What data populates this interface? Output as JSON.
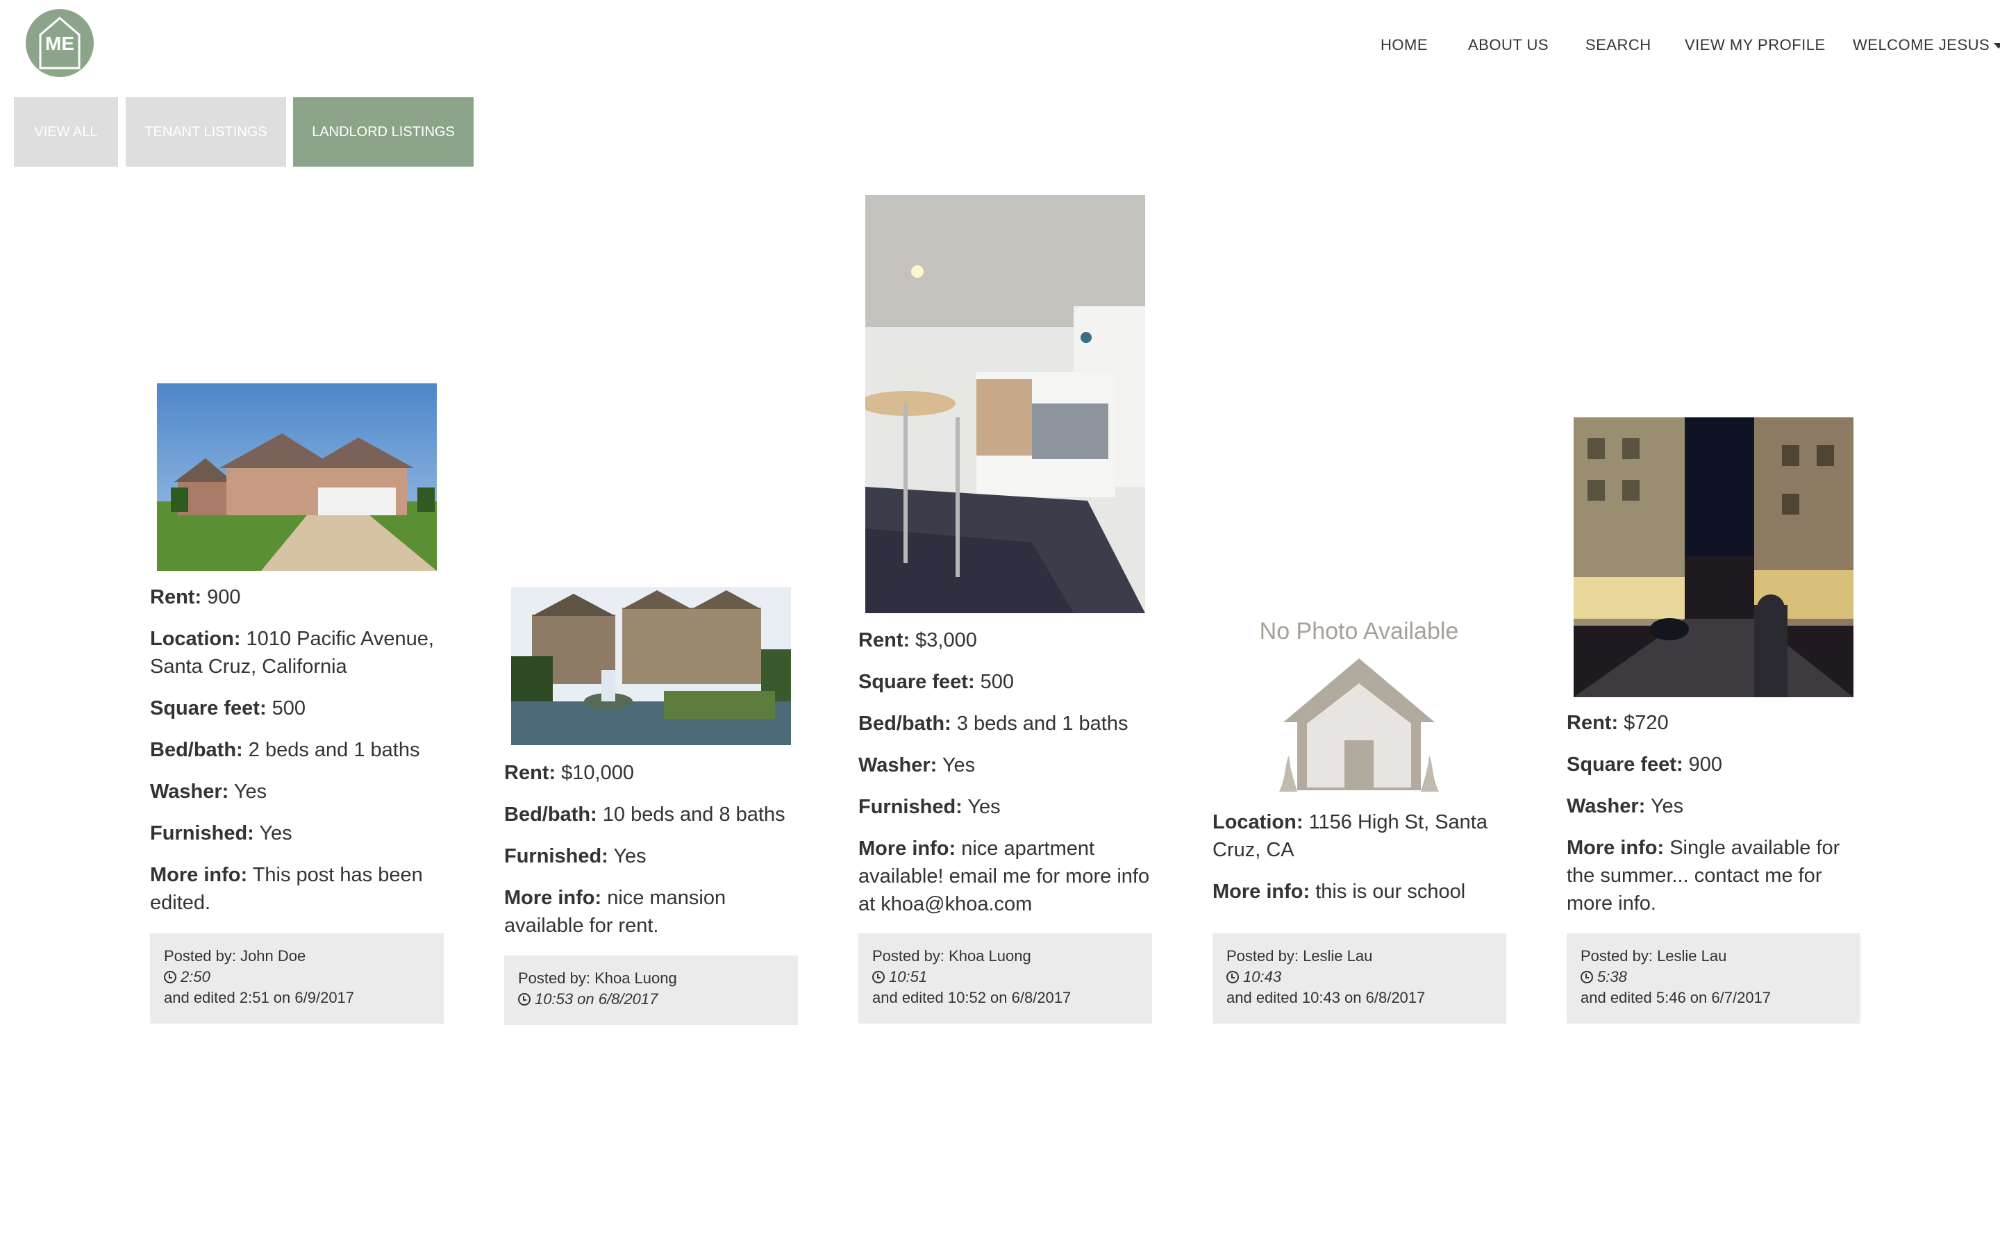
{
  "header": {
    "logo_text": "ME",
    "nav": {
      "home": "HOME",
      "about": "ABOUT US",
      "search": "SEARCH",
      "profile": "VIEW MY PROFILE",
      "welcome": "WELCOME JESUS"
    }
  },
  "tabs": {
    "view_all": "VIEW ALL",
    "tenant": "TENANT LISTINGS",
    "landlord": "LANDLORD LISTINGS"
  },
  "listings": [
    {
      "rent_label": "Rent:",
      "rent": " 900",
      "location_label": "Location:",
      "location": " 1010 Pacific Avenue, Santa Cruz, California",
      "sqft_label": "Square feet:",
      "sqft": " 500",
      "bedbath_label": "Bed/bath:",
      "bedbath": " 2 beds and 1 baths",
      "washer_label": "Washer:",
      "washer": " Yes",
      "furnished_label": "Furnished:",
      "furnished": " Yes",
      "info_label": "More info:",
      "info": " This post has been edited.",
      "posted_by": "Posted by: John Doe",
      "time": "2:50",
      "edited": "and edited 2:51 on 6/9/2017"
    },
    {
      "rent_label": "Rent:",
      "rent": " $10,000",
      "bedbath_label": "Bed/bath:",
      "bedbath": " 10 beds and 8 baths",
      "furnished_label": "Furnished:",
      "furnished": " Yes",
      "info_label": "More info:",
      "info": " nice mansion available for rent.",
      "posted_by": "Posted by: Khoa Luong",
      "time": "10:53 on 6/8/2017"
    },
    {
      "rent_label": "Rent:",
      "rent": " $3,000",
      "sqft_label": "Square feet:",
      "sqft": " 500",
      "bedbath_label": "Bed/bath:",
      "bedbath": " 3 beds and 1 baths",
      "washer_label": "Washer:",
      "washer": " Yes",
      "furnished_label": "Furnished:",
      "furnished": " Yes",
      "info_label": "More info:",
      "info": " nice apartment available! email me for more info at khoa@khoa.com",
      "posted_by": "Posted by: Khoa Luong",
      "time": "10:51",
      "edited": "and edited 10:52 on 6/8/2017"
    },
    {
      "no_photo": "No Photo Available",
      "location_label": "Location:",
      "location": " 1156 High St, Santa Cruz, CA",
      "info_label": "More info:",
      "info": " this is our school",
      "posted_by": "Posted by: Leslie Lau",
      "time": "10:43",
      "edited": "and edited 10:43 on 6/8/2017"
    },
    {
      "rent_label": "Rent:",
      "rent": " $720",
      "sqft_label": "Square feet:",
      "sqft": " 900",
      "washer_label": "Washer:",
      "washer": " Yes",
      "info_label": "More info:",
      "info": " Single available for the summer... contact me for more info.",
      "posted_by": "Posted by: Leslie Lau",
      "time": "5:38",
      "edited": "and edited 5:46 on 6/7/2017"
    }
  ],
  "colors": {
    "accent": "#8ca58a",
    "inactive_tab": "#dedede",
    "meta_bg": "#ebebeb"
  },
  "icons": [
    "house-logo-icon",
    "clock-icon",
    "caret-down-icon",
    "house-placeholder-icon"
  ]
}
